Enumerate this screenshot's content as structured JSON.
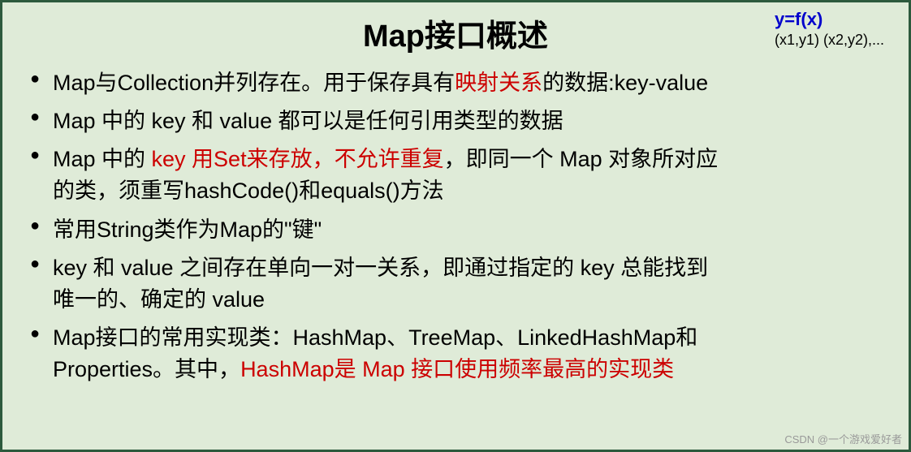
{
  "header": {
    "title": "Map接口概述",
    "formula_main": "y=f(x)",
    "formula_sub": "(x1,y1)  (x2,y2),..."
  },
  "bullets": {
    "b1_pre": "Map与Collection并列存在。用于保存具有",
    "b1_hl": "映射关系",
    "b1_post": "的数据:key-value",
    "b2": "Map 中的 key 和  value 都可以是任何引用类型的数据",
    "b3_pre": "Map 中的 ",
    "b3_hl1": "key 用Set来存放，不允许重复",
    "b3_mid": "，即同一个 Map 对象所对应",
    "b3_cont": "的类，须重写hashCode()和equals()方法",
    "b4": "常用String类作为Map的\"键\"",
    "b5_line1": "key 和 value 之间存在单向一对一关系，即通过指定的 key 总能找到",
    "b5_cont": "唯一的、确定的 value",
    "b6_line1": "Map接口的常用实现类：HashMap、TreeMap、LinkedHashMap和",
    "b6_cont_pre": "Properties。其中，",
    "b6_cont_hl": "HashMap是 Map 接口使用频率最高的实现类"
  },
  "watermark": "CSDN @一个游戏爱好者"
}
